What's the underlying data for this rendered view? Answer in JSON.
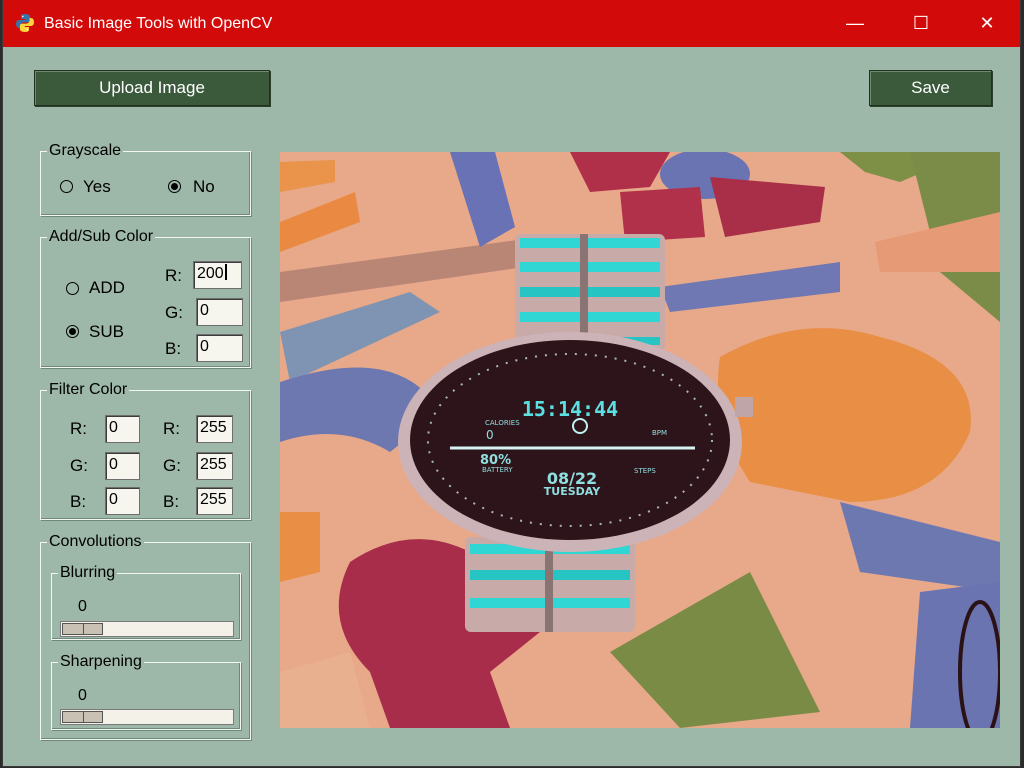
{
  "window": {
    "title": "Basic Image Tools with OpenCV",
    "min_glyph": "—",
    "max_glyph": "☐",
    "close_glyph": "✕"
  },
  "toolbar": {
    "upload_label": "Upload Image",
    "save_label": "Save"
  },
  "grayscale": {
    "title": "Grayscale",
    "options": [
      "Yes",
      "No"
    ],
    "selected": "No"
  },
  "add_sub": {
    "title": "Add/Sub Color",
    "modes": [
      "ADD",
      "SUB"
    ],
    "selected": "SUB",
    "r_label": "R:",
    "g_label": "G:",
    "b_label": "B:",
    "r": "200",
    "g": "0",
    "b": "0"
  },
  "filter_color": {
    "title": "Filter Color",
    "r_label": "R:",
    "g_label": "G:",
    "b_label": "B:",
    "low": {
      "r": "0",
      "g": "0",
      "b": "0"
    },
    "high": {
      "r": "255",
      "g": "255",
      "b": "255"
    }
  },
  "convolutions": {
    "title": "Convolutions",
    "blurring": {
      "title": "Blurring",
      "value": "0"
    },
    "sharpening": {
      "title": "Sharpening",
      "value": "0"
    }
  },
  "preview": {
    "watch_time": "15:14:44",
    "watch_calories_label": "CALORIES",
    "watch_calories": "0",
    "watch_battery_pct": "80%",
    "watch_battery_label": "BATTERY",
    "watch_date": "08/22",
    "watch_day": "TUESDAY",
    "watch_bpm_label": "BPM",
    "watch_steps_label": "STEPS"
  },
  "colors": {
    "titlebar": "#d30a0a",
    "panel": "#9db7a8",
    "button": "#3b5a3c"
  }
}
